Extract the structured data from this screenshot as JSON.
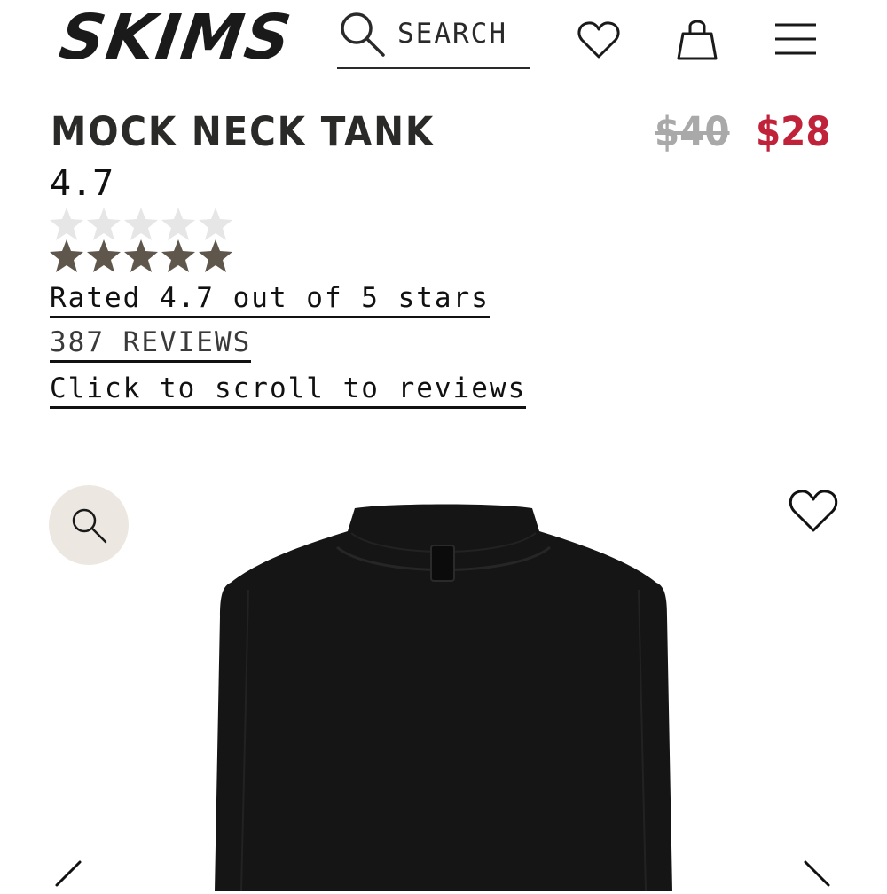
{
  "header": {
    "logo": "SKIMS",
    "search_label": "SEARCH",
    "icons": [
      "search-icon",
      "heart-icon",
      "shopping-bag-icon",
      "menu-icon"
    ]
  },
  "product": {
    "title": "MOCK NECK TANK",
    "price_original": "$40",
    "price_sale": "$28",
    "rating_value": "4.7",
    "rating_stars": 4.7,
    "rating_max": 5,
    "rated_text": "Rated 4.7 out of 5 stars",
    "reviews_link": "387 REVIEWS",
    "scroll_link": "Click to scroll to reviews"
  },
  "gallery": {
    "icons": [
      "zoom-icon",
      "wishlist-heart-icon",
      "chevron-left-icon",
      "chevron-right-icon"
    ]
  },
  "colors": {
    "text": "#1a1a1a",
    "sale": "#c0223a",
    "original_price": "#a9a9a9",
    "star_filled": "#5f564c",
    "star_empty": "#e6e6e6",
    "zoom_bg": "#ece8e1",
    "garment": "#151515"
  }
}
